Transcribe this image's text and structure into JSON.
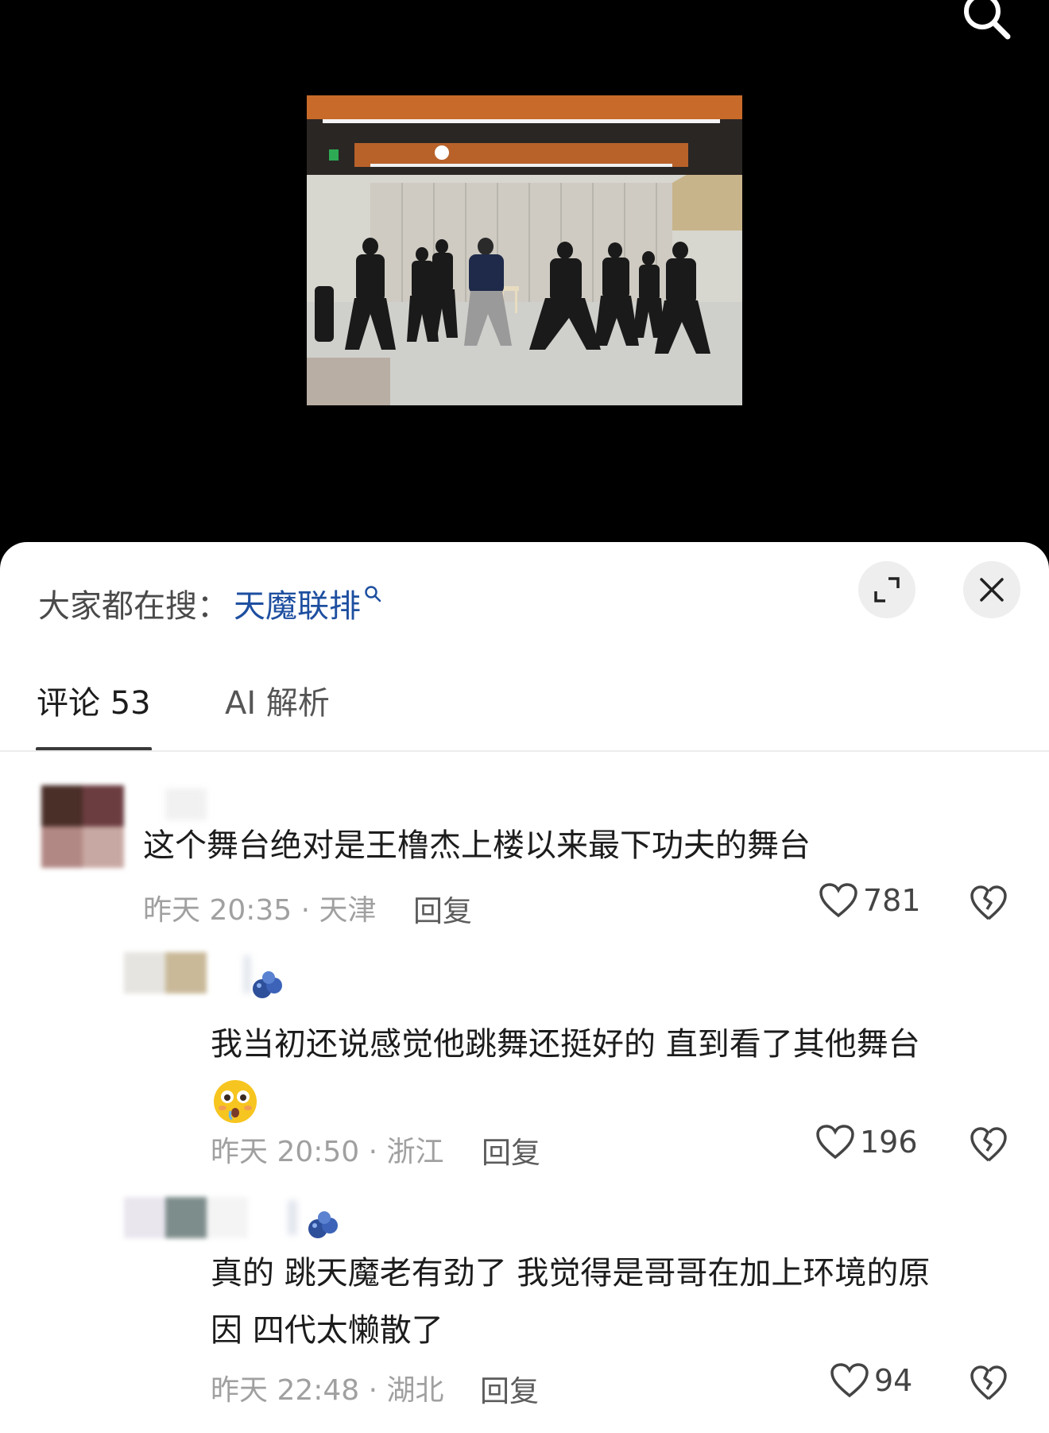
{
  "hot_search": {
    "prefix": "大家都在搜：",
    "keyword": "天魔联排"
  },
  "tabs": [
    {
      "label": "评论 53",
      "active": true
    },
    {
      "label": "AI 解析",
      "active": false
    }
  ],
  "comments": [
    {
      "text": "这个舞台绝对是王橹杰上楼以来最下功夫的舞台",
      "time": "昨天 20:35",
      "region": "天津",
      "meta": "昨天 20:35 · 天津",
      "reply_label": "回复",
      "likes": "781"
    },
    {
      "text": "我当初还说感觉他跳舞还挺好的 直到看了其他舞台",
      "emoji": "flushed-face",
      "time": "昨天 20:50",
      "region": "浙江",
      "meta": "昨天 20:50 · 浙江",
      "reply_label": "回复",
      "likes": "196"
    },
    {
      "text_line1": "真的 跳天魔老有劲了 我觉得是哥哥在加上环境的原",
      "text_line2": "因 四代太懒散了",
      "time": "昨天 22:48",
      "region": "湖北",
      "meta": "昨天 22:48 · 湖北",
      "reply_label": "回复",
      "likes": "94"
    }
  ],
  "colors": {
    "keyword": "#1e4fa0",
    "meta": "#a0a0a0",
    "text": "#1c1c1c"
  }
}
